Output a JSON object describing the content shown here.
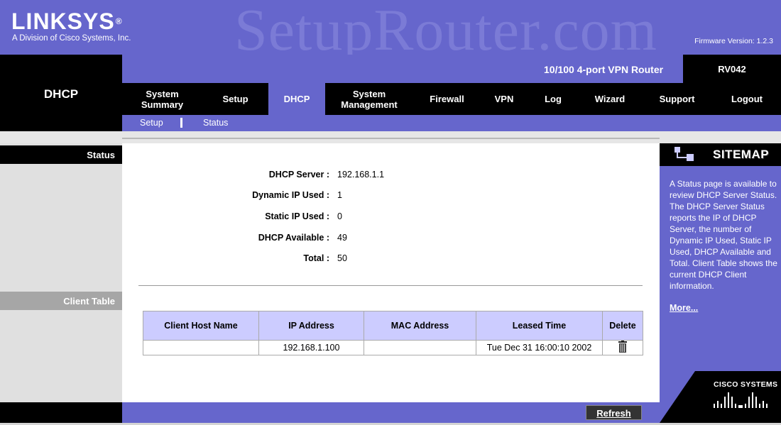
{
  "header": {
    "logo_text": "LINKSYS",
    "logo_reg": "®",
    "logo_subtitle": "A Division of Cisco Systems, Inc.",
    "watermark": "SetupRouter.com",
    "firmware": "Firmware Version: 1.2.3",
    "product_name": "10/100 4-port VPN Router",
    "model": "RV042"
  },
  "section_title": "DHCP",
  "tabs": [
    {
      "label": "System\nSummary"
    },
    {
      "label": "Setup"
    },
    {
      "label": "DHCP"
    },
    {
      "label": "System\nManagement"
    },
    {
      "label": "Firewall"
    },
    {
      "label": "VPN"
    },
    {
      "label": "Log"
    },
    {
      "label": "Wizard"
    },
    {
      "label": "Support"
    },
    {
      "label": "Logout"
    }
  ],
  "subnav": {
    "setup": "Setup",
    "status": "Status"
  },
  "left": {
    "status_label": "Status",
    "client_table_label": "Client Table"
  },
  "status": {
    "dhcp_server_label": "DHCP Server :",
    "dhcp_server_value": "192.168.1.1",
    "dynamic_ip_label": "Dynamic IP Used :",
    "dynamic_ip_value": "1",
    "static_ip_label": "Static IP Used :",
    "static_ip_value": "0",
    "available_label": "DHCP Available :",
    "available_value": "49",
    "total_label": "Total :",
    "total_value": "50"
  },
  "client_table": {
    "headers": [
      "Client Host Name",
      "IP Address",
      "MAC Address",
      "Leased Time",
      "Delete"
    ],
    "rows": [
      {
        "host": "",
        "ip": "192.168.1.100",
        "mac": "",
        "leased": "Tue Dec 31 16:00:10 2002"
      }
    ]
  },
  "refresh_label": "Refresh",
  "sitemap": {
    "title": "SITEMAP",
    "text": "A Status page is available to review DHCP Server Status. The DHCP Server Status reports the IP of DHCP Server, the number of Dynamic IP Used, Static IP Used, DHCP Available and Total. Client Table shows the current DHCP Client information.",
    "more": "More...",
    "cisco": "CISCO SYSTEMS"
  },
  "colors": {
    "primary": "#6666cc",
    "dark": "#000000",
    "table_header": "#ccccff"
  },
  "icons": {
    "delete": "trash-icon",
    "sitemap": "sitemap-icon",
    "cisco": "cisco-logo-icon"
  }
}
